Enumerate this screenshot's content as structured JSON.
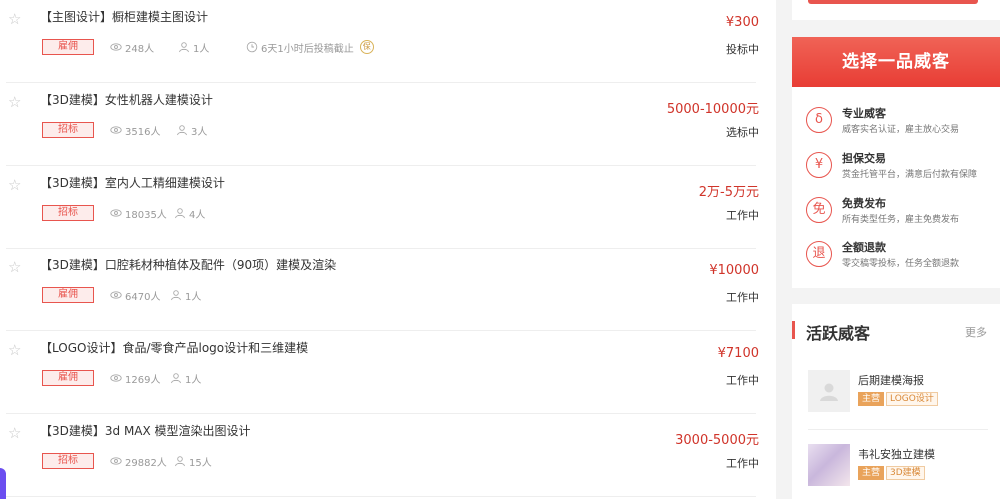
{
  "tasks": [
    {
      "title": "【主图设计】橱柜建模主图设计",
      "badge": "雇佣",
      "views": "248人",
      "bidders": "1人",
      "deadline": "6天1小时后投稿截止",
      "deadline_icon": "保",
      "price": "¥300",
      "status": "投标中"
    },
    {
      "title": "【3D建模】女性机器人建模设计",
      "badge": "招标",
      "views": "3516人",
      "bidders": "3人",
      "price": "5000-10000元",
      "status": "选标中"
    },
    {
      "title": "【3D建模】室内人工精细建模设计",
      "badge": "招标",
      "views": "18035人",
      "bidders": "4人",
      "price": "2万-5万元",
      "status": "工作中"
    },
    {
      "title": "【3D建模】口腔耗材种植体及配件（90项）建模及渲染",
      "badge": "雇佣",
      "views": "6470人",
      "bidders": "1人",
      "price": "¥10000",
      "status": "工作中"
    },
    {
      "title": "【LOGO设计】食品/零食产品logo设计和三维建模",
      "badge": "雇佣",
      "views": "1269人",
      "bidders": "1人",
      "price": "¥7100",
      "status": "工作中"
    },
    {
      "title": "【3D建模】3d MAX 模型渲染出图设计",
      "badge": "招标",
      "views": "29882人",
      "bidders": "15人",
      "price": "3000-5000元",
      "status": "工作中"
    }
  ],
  "why": {
    "title": "选择一品威客",
    "items": [
      {
        "icon": "rank-badge-icon",
        "glyph": "δ",
        "title": "专业威客",
        "desc": "威客实名认证，雇主放心交易"
      },
      {
        "icon": "yen-icon",
        "glyph": "¥",
        "title": "担保交易",
        "desc": "赏金托管平台，满意后付款有保障"
      },
      {
        "icon": "free-icon",
        "glyph": "免",
        "title": "免费发布",
        "desc": "所有类型任务，雇主免费发布"
      },
      {
        "icon": "refund-icon",
        "glyph": "退",
        "title": "全额退款",
        "desc": "零交稿零投标，任务全额退款"
      }
    ]
  },
  "active": {
    "title": "活跃威客",
    "more": "更多",
    "users": [
      {
        "name": "后期建模海报",
        "main_tag": "主营",
        "skill": "LOGO设计"
      },
      {
        "name": "韦礼安独立建模",
        "main_tag": "主营",
        "skill": "3D建模"
      }
    ]
  },
  "colors": {
    "accent": "#e8554e",
    "price": "#d0342a",
    "tag": "#e9a35b"
  }
}
